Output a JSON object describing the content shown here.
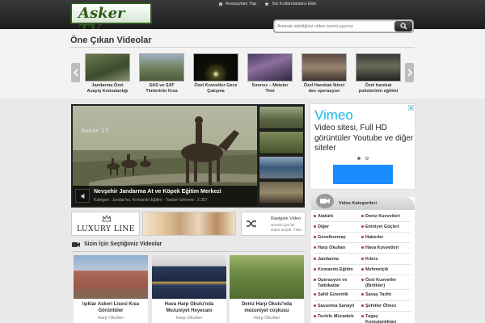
{
  "header": {
    "logo_text": "Asker TV",
    "links": [
      {
        "icon": "home-icon",
        "label": "Anasayfam Yap"
      },
      {
        "icon": "star-icon",
        "label": "Sık Kullanılanlara Ekle"
      }
    ],
    "search": {
      "placeholder": "Aramak istediğiniz video ismini yazınız",
      "value": ""
    }
  },
  "featured": {
    "title": "Öne Çıkan Videolar",
    "items": [
      "Jandarma Özel Asayiş Komutanlığı",
      "SAS ve SAT Timlerinin Kısa",
      "Özel Kuvvetler Gece Çatışma",
      "Sınırsız – Meteler Timi",
      "Özel Harekatı İkinci dev operasyon",
      "Özel harekat polislerinin eğitimi"
    ]
  },
  "main_video": {
    "watermark": "Asker TV",
    "title": "Nevşehir Jandarma At ve Köpek Eğitim Merkezi",
    "meta": "Kategori : Jandarma, Komando Eğitim  -  Toplam İzlenme : 2.357"
  },
  "ad": {
    "brand": "Vimeo",
    "text": "Video sitesi, Full HD görüntüler Youtube ve diğer siteler",
    "slide_index": 1,
    "slide_count": 2,
    "colors": {
      "brand": "#1ab7ea",
      "button": "#1a8cff"
    }
  },
  "banners": {
    "luxury": "LUXURY LINE"
  },
  "random": {
    "title": "Rastgele Video",
    "subtitle": "Sensin için bir video seçtik. Tıkla"
  },
  "selected": {
    "title": "Sizin İçin Seçtiğimiz Videolar",
    "items": [
      {
        "title": "Işıklar Askeri Lisesi Kısa Görüntüler",
        "category": "Harp Okulları"
      },
      {
        "title": "Hava Harp Okulu'nda Mezuniyet Heyecanı",
        "category": "Harp Okulları"
      },
      {
        "title": "Deniz Harp Okulu'nda mezuniyet coşkusu",
        "category": "Harp Okulları"
      }
    ]
  },
  "categories": {
    "title": "Video Kategorileri",
    "left": [
      "Atatürk",
      "Diğer",
      "Genelkurmay",
      "Harp Okulları",
      "Jandarma",
      "Komando Eğitim",
      "Operasyon ve Tatbikatlar",
      "Sahil Güvenlik",
      "Savunma Sanayii",
      "Terörle Mücadele"
    ],
    "right": [
      "Deniz Kuvvetleri",
      "Emniyet Güçleri",
      "Haberler",
      "Hava Kuvvetleri",
      "Kıbrıs",
      "Mehmetçik",
      "Özel Kuvvetler (Birlikler)",
      "Savaş Tarihi",
      "Şehitler Ölmez",
      "Tugay Komutanlıkları"
    ]
  }
}
